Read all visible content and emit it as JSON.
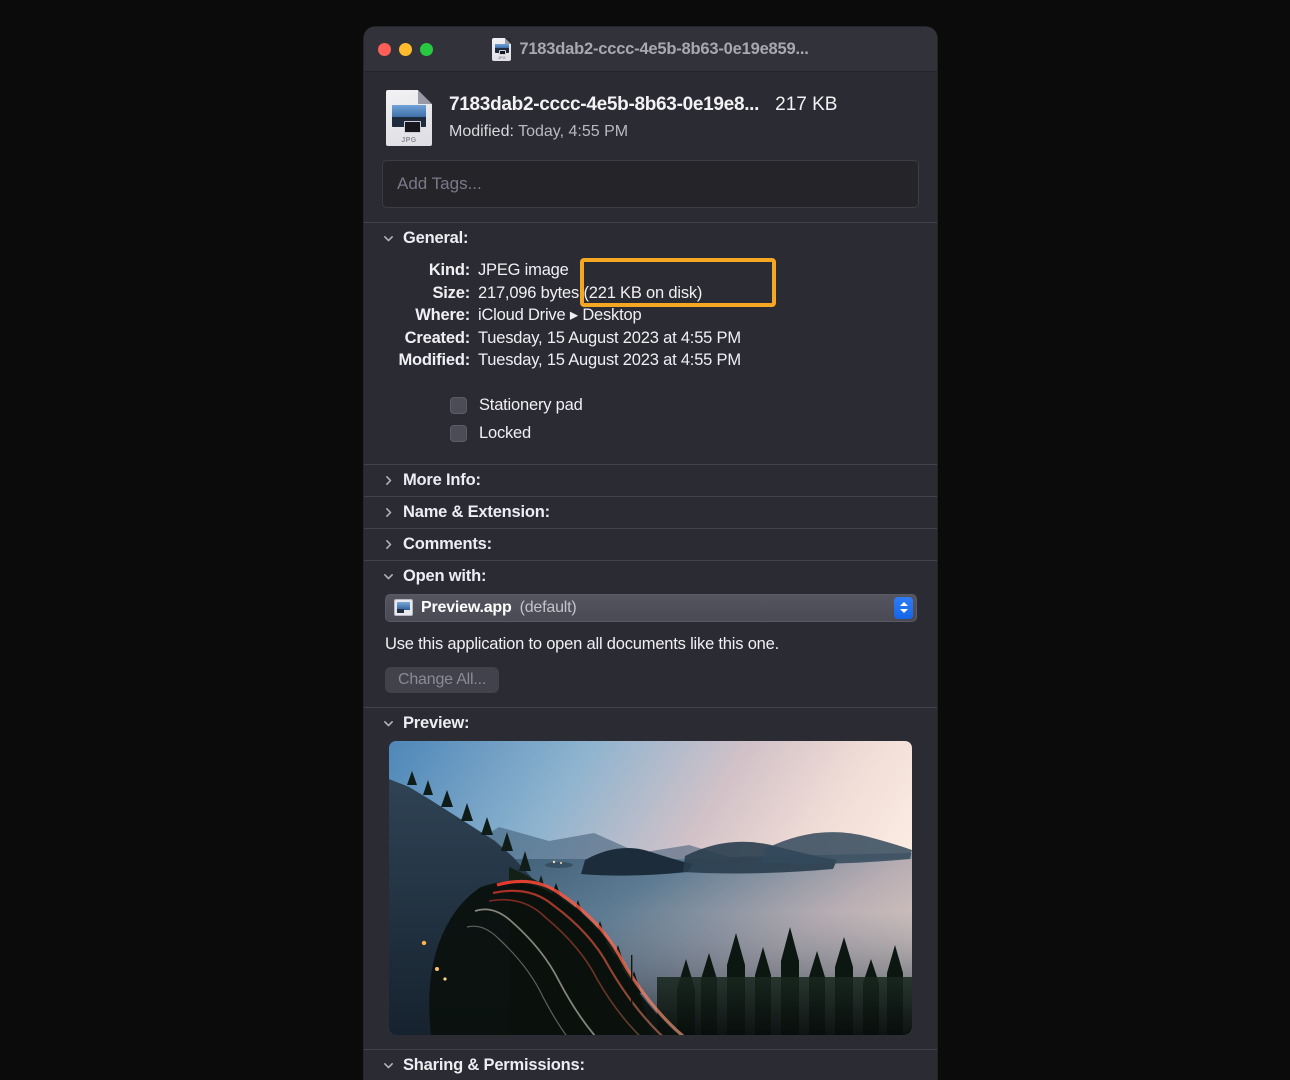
{
  "window": {
    "title": "7183dab2-cccc-4e5b-8b63-0e19e859...",
    "title_icon": "jpg-document-icon",
    "traffic_lights": {
      "close_label": "close",
      "minimize_label": "minimize",
      "zoom_label": "zoom",
      "close_color": "#ff5f57",
      "minimize_color": "#febc2e",
      "zoom_color": "#28c840"
    }
  },
  "file_header": {
    "icon": "jpg-document-icon",
    "name": "7183dab2-cccc-4e5b-8b63-0e19e8...",
    "size": "217 KB",
    "modified_label": "Modified:",
    "modified_value": "Today, 4:55 PM"
  },
  "tags": {
    "placeholder": "Add Tags...",
    "value": ""
  },
  "sections": {
    "general": {
      "title": "General:",
      "expanded": true,
      "rows": [
        {
          "key": "Kind:",
          "value": "JPEG image"
        },
        {
          "key": "Size:",
          "value": "217,096 bytes (221 KB on disk)"
        },
        {
          "key": "Where:",
          "value": "iCloud Drive ▸ Desktop"
        },
        {
          "key": "Created:",
          "value": "Tuesday, 15 August 2023 at 4:55 PM"
        },
        {
          "key": "Modified:",
          "value": "Tuesday, 15 August 2023 at 4:55 PM"
        }
      ],
      "checkboxes": [
        {
          "label": "Stationery pad",
          "checked": false
        },
        {
          "label": "Locked",
          "checked": false
        }
      ]
    },
    "more_info": {
      "title": "More Info:",
      "expanded": false
    },
    "name_extension": {
      "title": "Name & Extension:",
      "expanded": false
    },
    "comments": {
      "title": "Comments:",
      "expanded": false
    },
    "open_with": {
      "title": "Open with:",
      "expanded": true,
      "app_icon": "preview-app-icon",
      "app_name": "Preview.app",
      "app_default_suffix": "(default)",
      "note": "Use this application to open all documents like this one.",
      "change_all_label": "Change All...",
      "change_all_disabled": true
    },
    "preview": {
      "title": "Preview:",
      "expanded": true,
      "image_description": "Twilight coastal highway with car light trails, forested hillside, calm sea and islands"
    },
    "sharing_permissions": {
      "title": "Sharing & Permissions:",
      "expanded": true
    }
  },
  "annotation": {
    "type": "highlight-rectangle",
    "color": "#f5a623",
    "targets": "Size: 217,096 bytes (221 KB on disk)"
  }
}
